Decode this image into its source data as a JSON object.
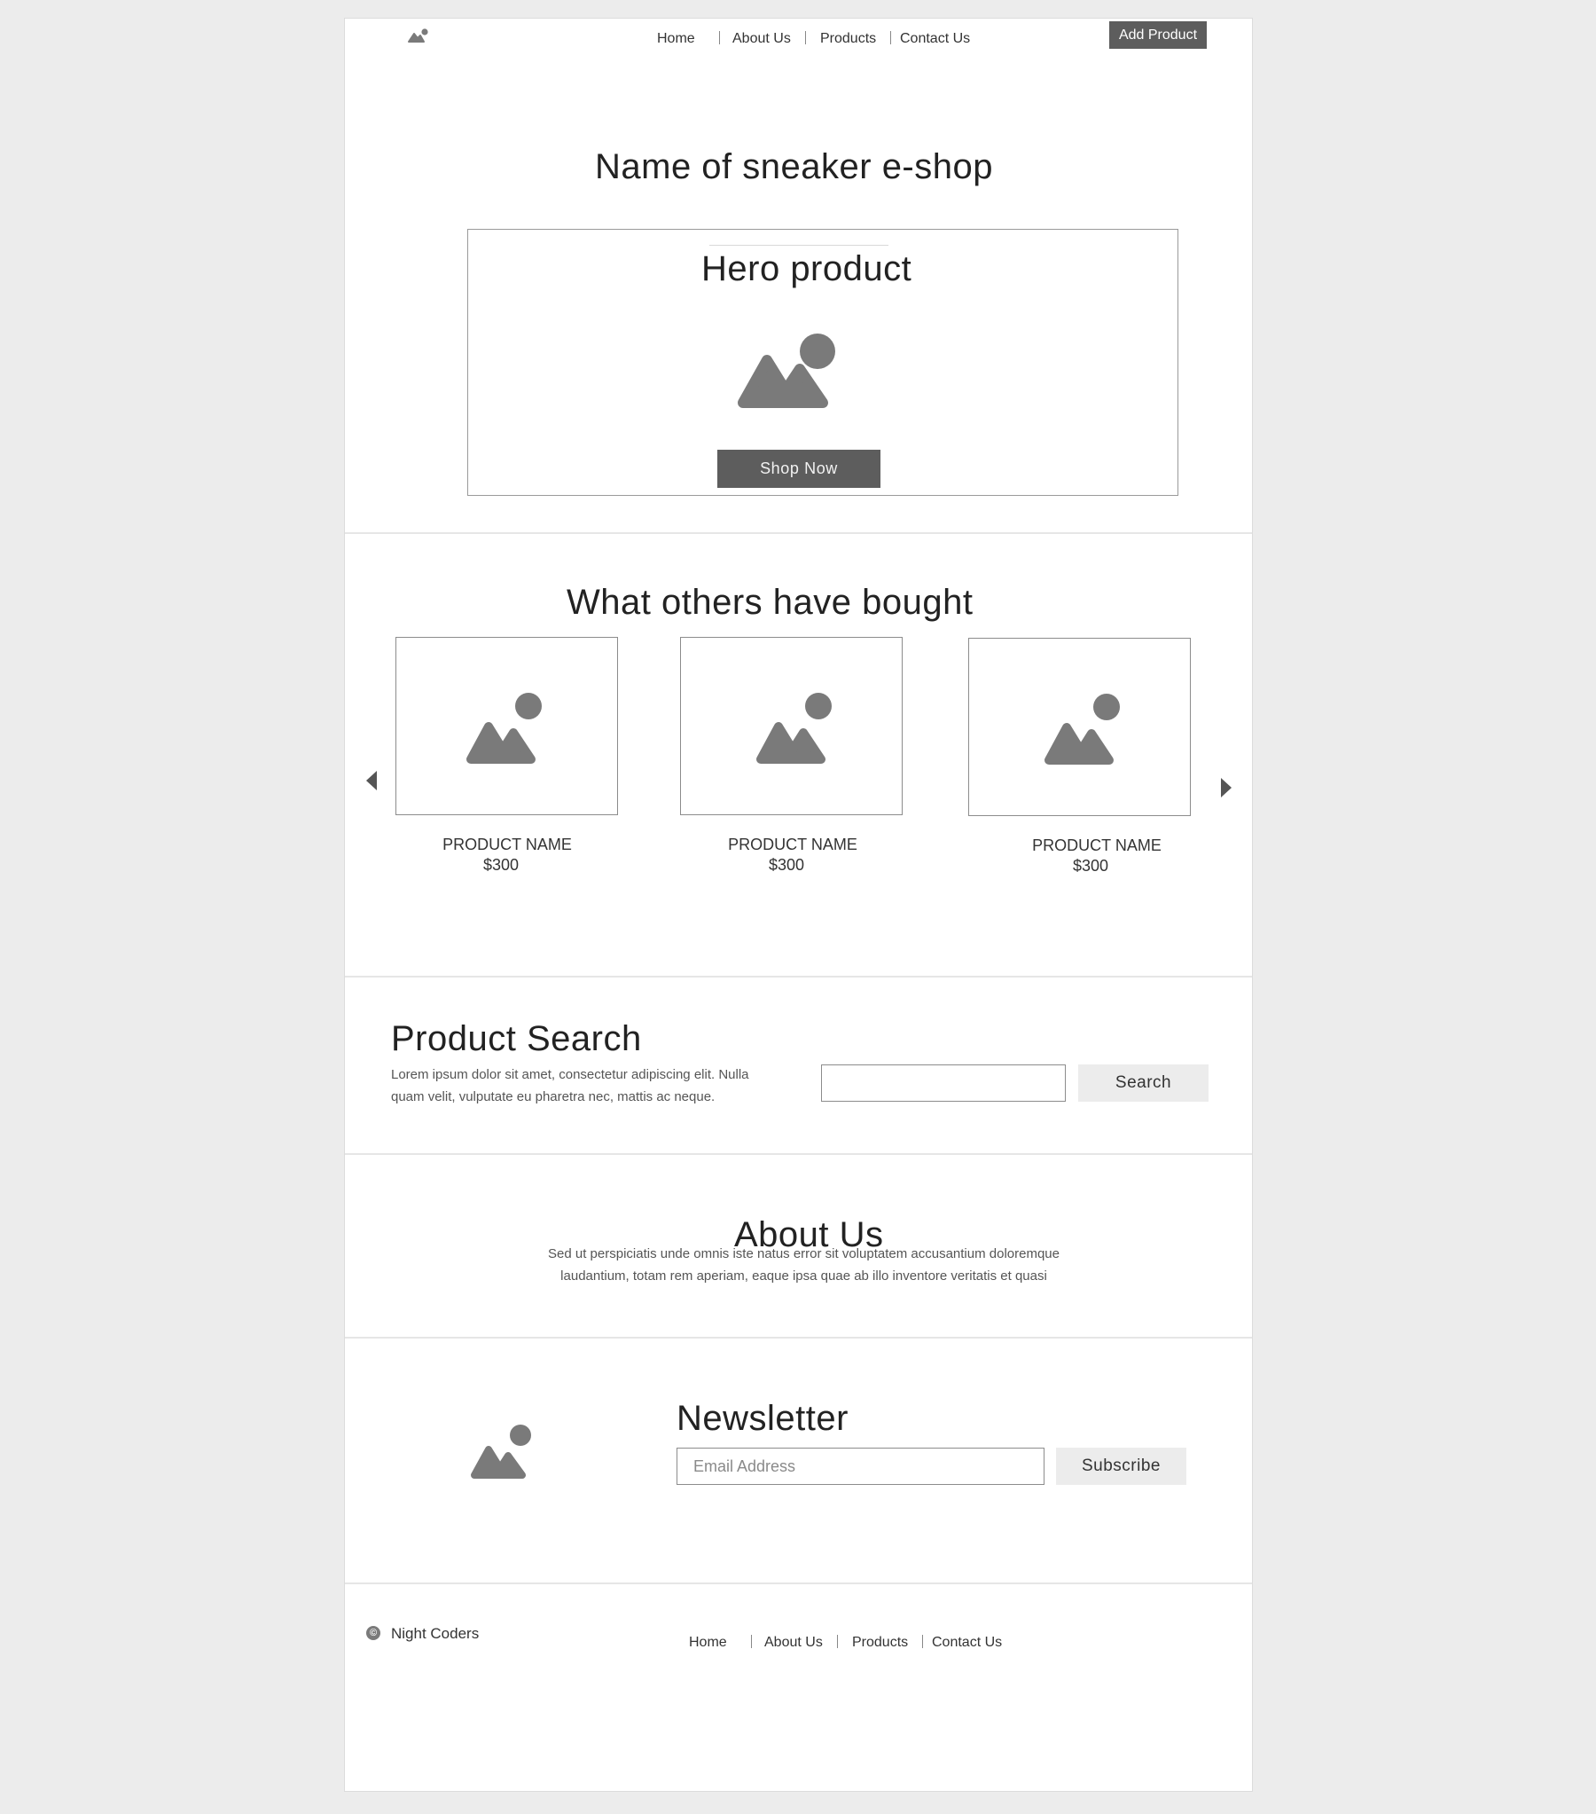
{
  "header": {
    "logo_icon": "image-placeholder-icon",
    "nav": [
      "Home",
      "About Us",
      "Products",
      "Contact Us"
    ],
    "add_product_label": "Add Product"
  },
  "hero": {
    "site_title": "Name of sneaker e-shop",
    "product_title": "Hero product",
    "image_icon": "image-placeholder-icon",
    "shop_now_label": "Shop Now"
  },
  "others": {
    "title": "What others have bought",
    "products": [
      {
        "name": "PRODUCT NAME",
        "price": "$300"
      },
      {
        "name": "PRODUCT NAME",
        "price": "$300"
      },
      {
        "name": "PRODUCT NAME",
        "price": "$300"
      }
    ]
  },
  "search": {
    "title": "Product Search",
    "text_line1": "Lorem ipsum dolor sit amet, consectetur adipiscing elit. Nulla",
    "text_line2": "quam velit, vulputate eu pharetra nec, mattis ac neque.",
    "input_value": "",
    "button_label": "Search"
  },
  "about": {
    "title": "About Us",
    "text_line1": "Sed ut perspiciatis unde omnis iste natus error sit voluptatem accusantium doloremque",
    "text_line2": "laudantium, totam rem aperiam, eaque ipsa quae ab illo inventore veritatis et quasi"
  },
  "newsletter": {
    "title": "Newsletter",
    "email_placeholder": "Email Address",
    "subscribe_label": "Subscribe"
  },
  "footer": {
    "copyright_symbol": "©",
    "company": "Night Coders",
    "nav": [
      "Home",
      "About Us",
      "Products",
      "Contact Us"
    ]
  },
  "colors": {
    "background": "#ececec",
    "button_dark": "#5d5d5d",
    "button_light": "#ececec",
    "icon_grey": "#7a7a7a"
  }
}
